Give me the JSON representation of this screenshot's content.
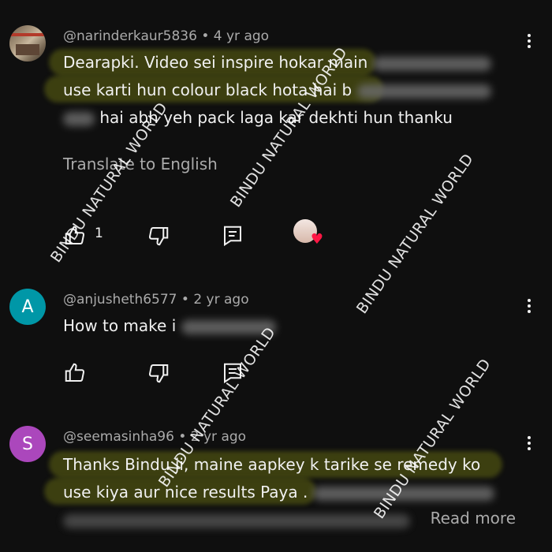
{
  "comments": [
    {
      "author": "@narinderkaur5836",
      "age": "4 yr ago",
      "avatar_kind": "photo",
      "lines": [
        "Dearapki. Video sei inspire hokar main",
        "use karti hun colour black hota hai b",
        "hai abh yeh pack laga kar dekhti hun thanku"
      ],
      "translate_label": "Translate to English",
      "like_count": "1"
    },
    {
      "author": "@anjusheth6577",
      "age": "2 yr ago",
      "avatar_letter": "A",
      "avatar_color": "#0097a7",
      "lines": [
        "How to make i"
      ]
    },
    {
      "author": "@seemasinha96",
      "age": "2 yr ago",
      "avatar_letter": "S",
      "avatar_color": "#ab47bc",
      "lines": [
        "Thanks Bindu ji, maine aapkey k tarike se remedy ko",
        "use kiya aur nice results Paya ."
      ],
      "read_more_label": "Read more"
    }
  ],
  "watermark_text": "BINDU NATURAL WORLD",
  "colors": {
    "background": "#0f0f0f",
    "text": "#f1f1f1",
    "secondary": "#aaaaaa",
    "highlight": "#b4be14",
    "heart": "#ff1744"
  }
}
